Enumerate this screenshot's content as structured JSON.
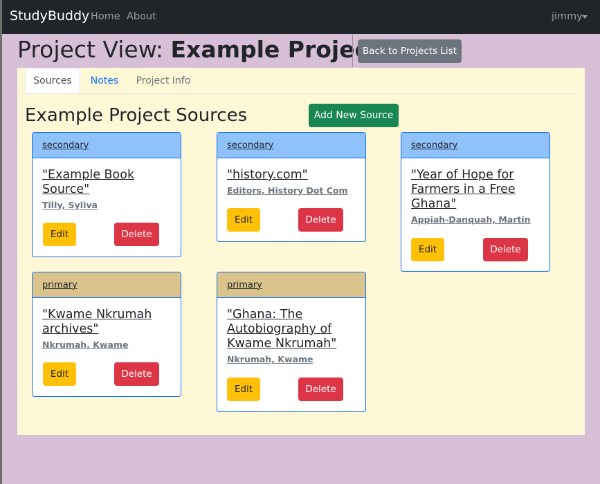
{
  "navbar": {
    "brand": "StudyBuddy",
    "links": [
      "Home",
      "About"
    ],
    "user": "jimmy"
  },
  "page": {
    "title_prefix": "Project View: ",
    "title_project": "Example Project",
    "back_button": "Back to Projects List"
  },
  "tabs": [
    "Sources",
    "Notes",
    "Project Info"
  ],
  "sources": {
    "heading": "Example Project Sources",
    "add_button": "Add New Source",
    "cards": [
      {
        "type": "secondary",
        "title": "\"Example Book Source\"",
        "author": "Tilly, Syliva",
        "edit": "Edit",
        "delete": "Delete"
      },
      {
        "type": "secondary",
        "title": "\"history.com\"",
        "author": "Editors, History Dot Com",
        "edit": "Edit",
        "delete": "Delete"
      },
      {
        "type": "secondary",
        "title": "\"Year of Hope for Farmers in a Free Ghana\"",
        "author": "Appiah-Danquah, Martin",
        "edit": "Edit",
        "delete": "Delete"
      },
      {
        "type": "primary",
        "title": "\"Kwame Nkrumah archives\"",
        "author": "Nkrumah, Kwame",
        "edit": "Edit",
        "delete": "Delete"
      },
      {
        "type": "primary",
        "title": "\"Ghana: The Autobiography of Kwame Nkrumah\"",
        "author": "Nkrumah, Kwame",
        "edit": "Edit",
        "delete": "Delete"
      }
    ]
  },
  "colors": {
    "page_bg": "#d8bfd8",
    "panel_bg": "#fff8d6",
    "navbar_bg": "#212529",
    "secondary_header": "#8fc2fb",
    "primary_header": "#dbc48b",
    "edit": "#ffc107",
    "delete": "#dc3545",
    "add": "#198754",
    "back": "#6c757d"
  }
}
